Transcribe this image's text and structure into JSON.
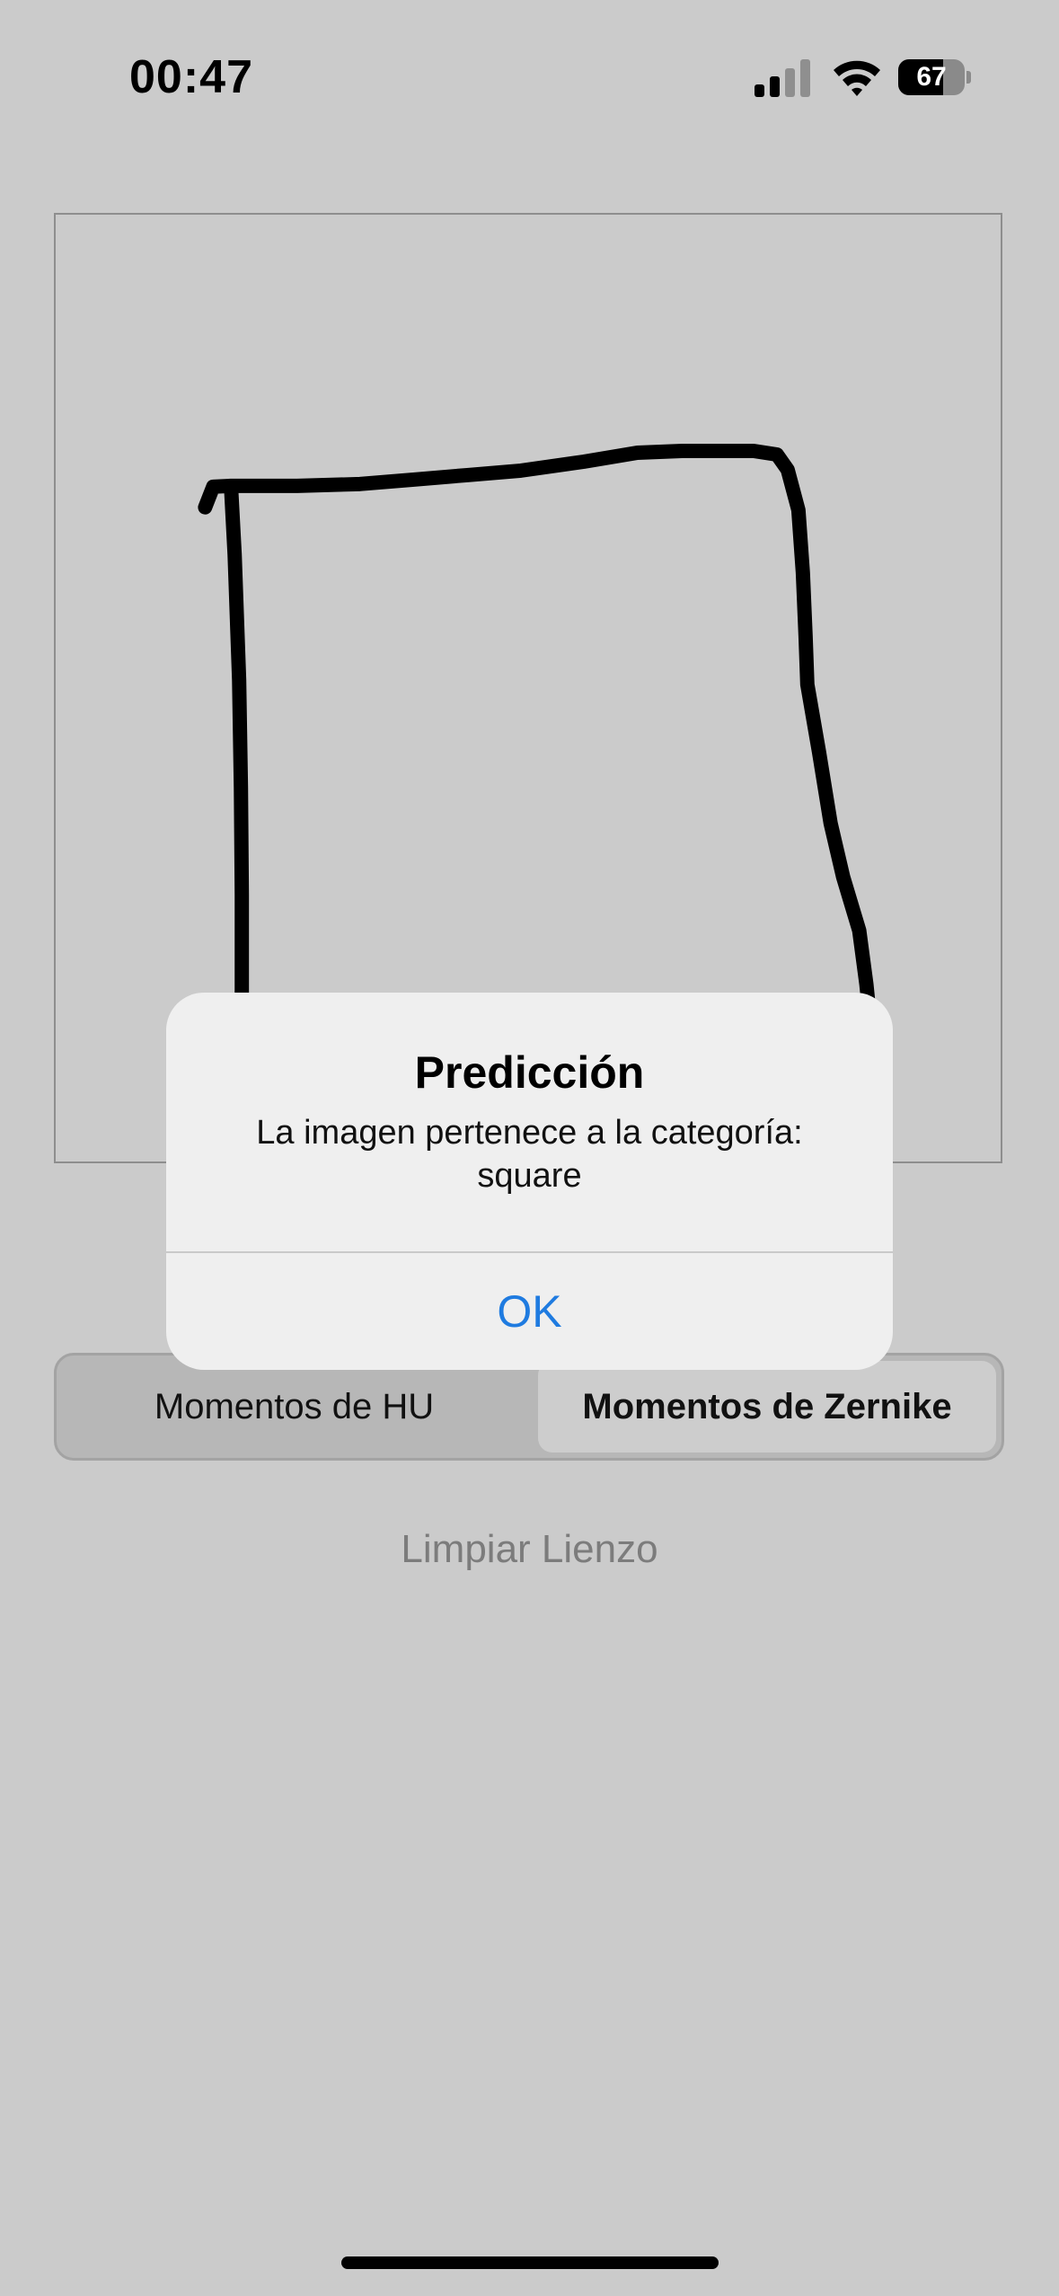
{
  "status_bar": {
    "time": "00:47",
    "battery_level": "67",
    "icons": [
      "cellular-signal-icon",
      "wifi-icon",
      "battery-icon"
    ]
  },
  "canvas": {
    "stroke_color": "#000000"
  },
  "segmented_control": {
    "options": [
      "Momentos de HU",
      "Momentos de Zernike"
    ],
    "selected": "Momentos de Zernike"
  },
  "clear_button": {
    "label": "Limpiar Lienzo"
  },
  "alert": {
    "title": "Predicción",
    "message": "La imagen pertenece a la categoría: square",
    "ok_label": "OK"
  },
  "colors": {
    "background": "#cbcbcb",
    "accent": "#1f7be0",
    "alert_background": "#efefef"
  }
}
